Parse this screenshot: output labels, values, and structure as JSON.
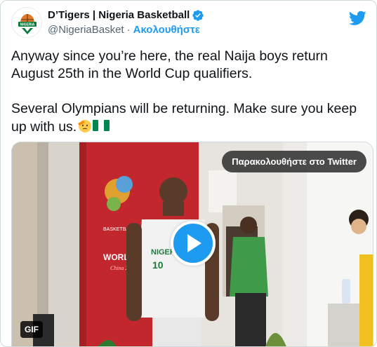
{
  "tweet": {
    "author": {
      "display_name": "D’Tigers | Nigeria Basketball",
      "handle": "@NigeriaBasket",
      "separator": "·",
      "follow_label": "Ακολουθήστε",
      "verified": true,
      "avatar_text": "NIGERIA"
    },
    "text": {
      "paragraph_1": "Anyway since you’re here, the real Naija boys return August 25th in the World Cup qualifiers.",
      "paragraph_2": "Several Olympians will be returning. Make sure you keep up with us."
    },
    "media": {
      "watch_label": "Παρακολουθήστε στο Twitter",
      "badge": "GIF",
      "jersey_text": "NIGERIA",
      "jersey_number": "10",
      "banner_text": "BASKETBALL WORLD CUP",
      "banner_sub": "China 2019"
    },
    "icons": {
      "verified": "verified-badge-icon",
      "logo": "twitter-logo-icon",
      "play": "play-icon",
      "emoji_1": "saluting-face-emoji",
      "emoji_2": "nigeria-flag-emoji"
    },
    "colors": {
      "accent": "#1d9bf0",
      "text": "#0f1419",
      "secondary": "#536471",
      "jersey": "#f2f2f2",
      "wall_red": "#c2272d",
      "nigeria_green": "#008751"
    }
  }
}
